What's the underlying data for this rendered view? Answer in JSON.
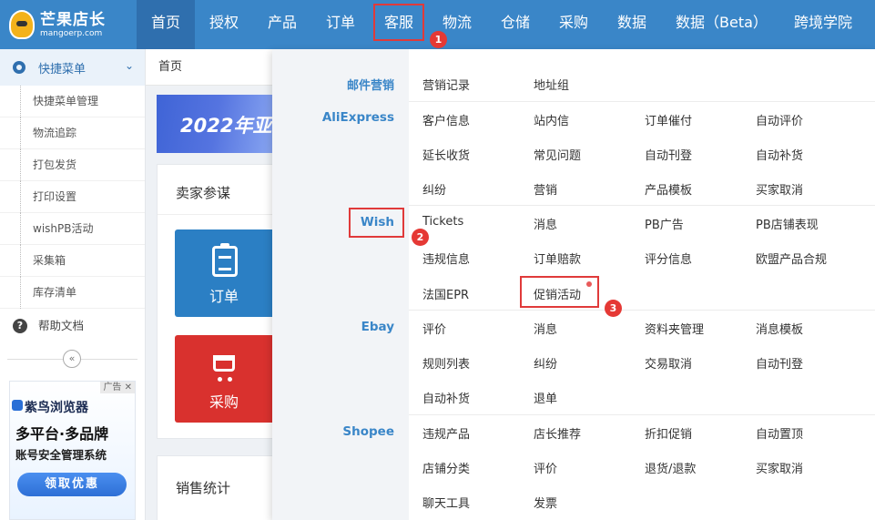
{
  "app": {
    "logo_name": "芒果店长",
    "logo_url": "mangoerp.com"
  },
  "nav": {
    "items": [
      "首页",
      "授权",
      "产品",
      "订单",
      "客服",
      "物流",
      "仓储",
      "采购",
      "数据",
      "数据（Beta）",
      "跨境学院"
    ],
    "active": "首页",
    "open": "客服"
  },
  "sidebar": {
    "header": "快捷菜单",
    "items": [
      "快捷菜单管理",
      "物流追踪",
      "打包发货",
      "打印设置",
      "wishPB活动",
      "采集箱",
      "库存清单"
    ],
    "help": "帮助文档"
  },
  "ad": {
    "tag": "广告",
    "brand": "紫鸟浏览器",
    "line1": "多平台·多品牌",
    "line2": "账号安全管理系统",
    "button": "领取优惠"
  },
  "main": {
    "breadcrumb": "首页",
    "banner_text": "2022年亚",
    "section1_title": "卖家参谋",
    "tile_order": "订单",
    "tile_purchase": "采购",
    "section2_title": "销售统计"
  },
  "dropdown": {
    "categories": {
      "email": "邮件营销",
      "aliexpress": "AliExpress",
      "wish": "Wish",
      "ebay": "Ebay",
      "shopee": "Shopee"
    },
    "email_items": [
      "营销记录",
      "地址组"
    ],
    "aliexpress_items": [
      "客户信息",
      "站内信",
      "订单催付",
      "自动评价",
      "延长收货",
      "常见问题",
      "自动刊登",
      "自动补货",
      "纠纷",
      "营销",
      "产品模板",
      "买家取消"
    ],
    "wish_items": [
      "Tickets",
      "消息",
      "PB广告",
      "PB店铺表现",
      "违规信息",
      "订单赔款",
      "评分信息",
      "欧盟产品合规",
      "法国EPR",
      "促销活动"
    ],
    "ebay_items": [
      "评价",
      "消息",
      "资料夹管理",
      "消息模板",
      "规则列表",
      "纠纷",
      "交易取消",
      "自动刊登",
      "自动补货",
      "退单"
    ],
    "shopee_items": [
      "违规产品",
      "店长推荐",
      "折扣促销",
      "自动置顶",
      "店铺分类",
      "评价",
      "退货/退款",
      "买家取消",
      "聊天工具",
      "发票"
    ]
  },
  "annotations": {
    "step1": "1",
    "step2": "2",
    "step3": "3"
  },
  "colors": {
    "nav_bg": "#3a86c8",
    "nav_active": "#2f6fae",
    "category_text": "#3a86c8",
    "highlight_red": "#e03a3a",
    "tile_blue": "#2b7fc4",
    "tile_red": "#d9312e"
  }
}
